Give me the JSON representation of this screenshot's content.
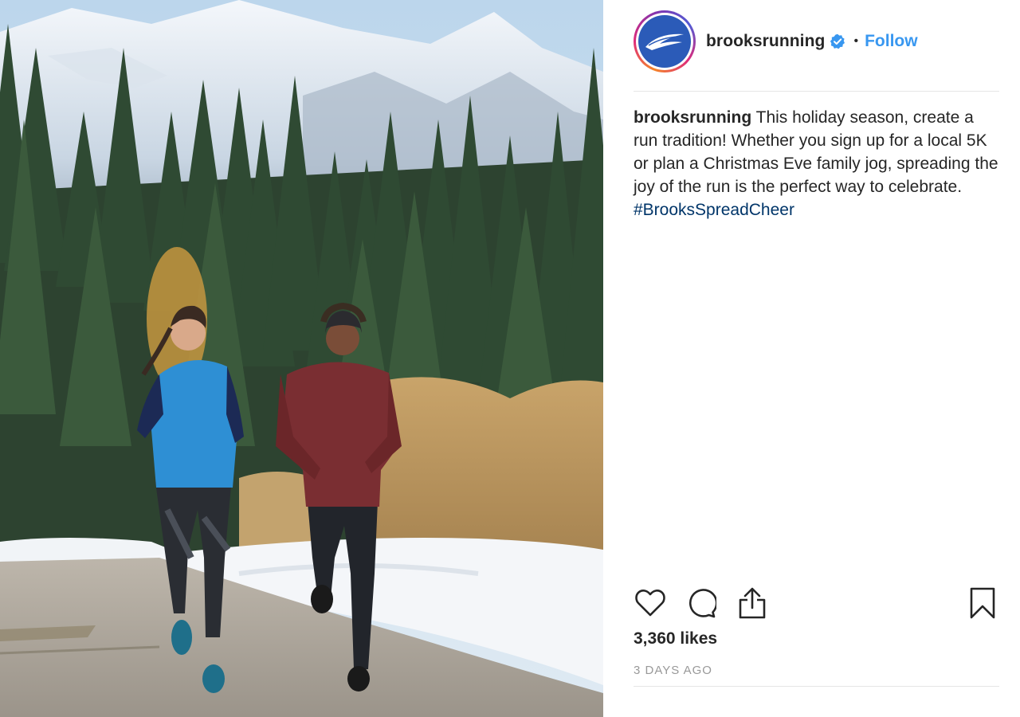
{
  "post": {
    "username": "brooksrunning",
    "verified": true,
    "separator": "•",
    "follow_label": "Follow",
    "caption": {
      "username": "brooksrunning",
      "text": " This holiday season, create a run tradition! Whether you sign up for a local 5K or plan a Christmas Eve family jog, spreading the joy of the run is the perfect way to celebrate. ",
      "hashtag": "#BrooksSpreadCheer"
    },
    "likes": "3,360 likes",
    "timestamp": "3 DAYS AGO"
  },
  "icons": {
    "like": "heart-icon",
    "comment": "comment-bubble-icon",
    "share": "share-icon",
    "save": "bookmark-icon",
    "verified": "verified-badge-icon"
  },
  "colors": {
    "follow": "#3897f0",
    "hashtag": "#003569",
    "avatar_bg": "#2b5bb8",
    "muted": "#999999"
  }
}
